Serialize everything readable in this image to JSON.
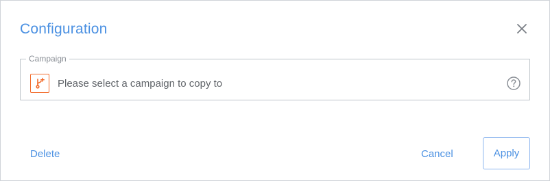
{
  "dialog": {
    "title": "Configuration",
    "close_icon": "close-icon"
  },
  "campaign": {
    "label": "Campaign",
    "placeholder": "Please select a campaign to copy to",
    "leading_icon": "branch-icon",
    "trailing_icon": "help-icon"
  },
  "footer": {
    "delete_label": "Delete",
    "cancel_label": "Cancel",
    "apply_label": "Apply"
  },
  "colors": {
    "accent": "#4a90e2",
    "icon_orange": "#f26b2b",
    "border": "#bdc3c9",
    "text_muted": "#5f6368"
  }
}
